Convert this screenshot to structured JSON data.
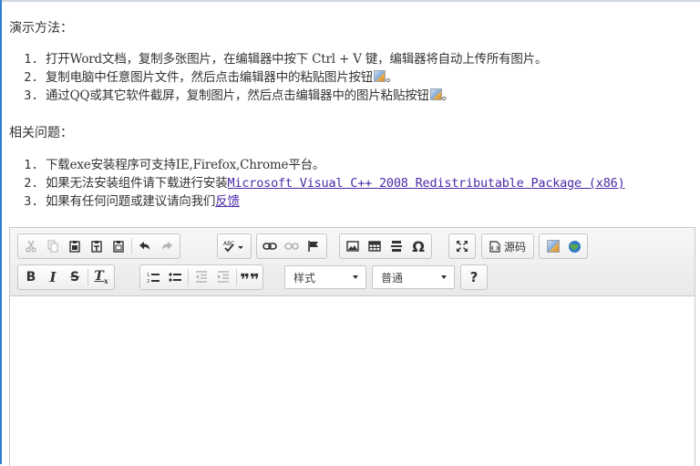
{
  "demo": {
    "heading": "演示方法：",
    "items": [
      {
        "pre": "打开Word文档，复制多张图片，在编辑器中按下 Ctrl + V 键，编辑器将自动上传所有图片。",
        "post": ""
      },
      {
        "pre": "复制电脑中任意图片文件，然后点击编辑器中的粘贴图片按钮",
        "post": "。"
      },
      {
        "pre": "通过QQ或其它软件截屏，复制图片，然后点击编辑器中的图片粘贴按钮",
        "post": "。"
      }
    ]
  },
  "related": {
    "heading": "相关问题：",
    "items": [
      {
        "pre": "下载exe安装程序可支持IE,Firefox,Chrome平台。",
        "link": ""
      },
      {
        "pre": "如果无法安装组件请下载进行安装",
        "link": "Microsoft Visual C++ 2008 Redistributable Package (x86)"
      },
      {
        "pre": "如果有任何问题或建议请向我们",
        "link": "反馈"
      }
    ]
  },
  "toolbar": {
    "source_label": "源码",
    "format_combo": "样式",
    "paragraph_combo": "普通",
    "help_label": "?"
  },
  "colors": {
    "link": "#4b2aa8",
    "accent_edge": "#2f7fcf"
  }
}
